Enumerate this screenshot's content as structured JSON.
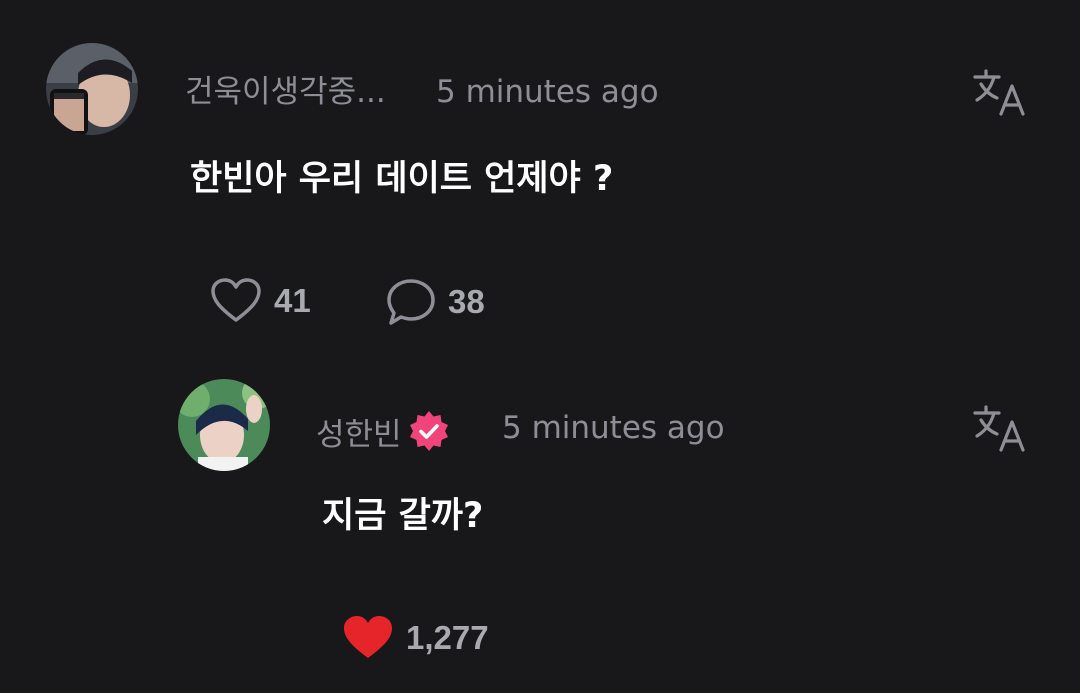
{
  "comment": {
    "username": "건욱이생각중...",
    "timestamp": "5 minutes ago",
    "text": "한빈아 우리 데이트 언제야 ?",
    "likes": "41",
    "replies": "38",
    "icons": {
      "translate": "translate-icon",
      "like": "heart-outline-icon",
      "reply": "speech-bubble-icon"
    }
  },
  "reply": {
    "username": "성한빈",
    "verified": true,
    "timestamp": "5 minutes ago",
    "text": "지금 갈까?",
    "likes": "1,277",
    "icons": {
      "translate": "translate-icon",
      "like": "heart-filled-icon",
      "verified": "verified-badge-icon"
    }
  },
  "colors": {
    "background": "#18181b",
    "muted_text": "#8e8e96",
    "count_text": "#a9a9b0",
    "liked_heart": "#e5252a",
    "verified_badge": "#f0457a"
  }
}
